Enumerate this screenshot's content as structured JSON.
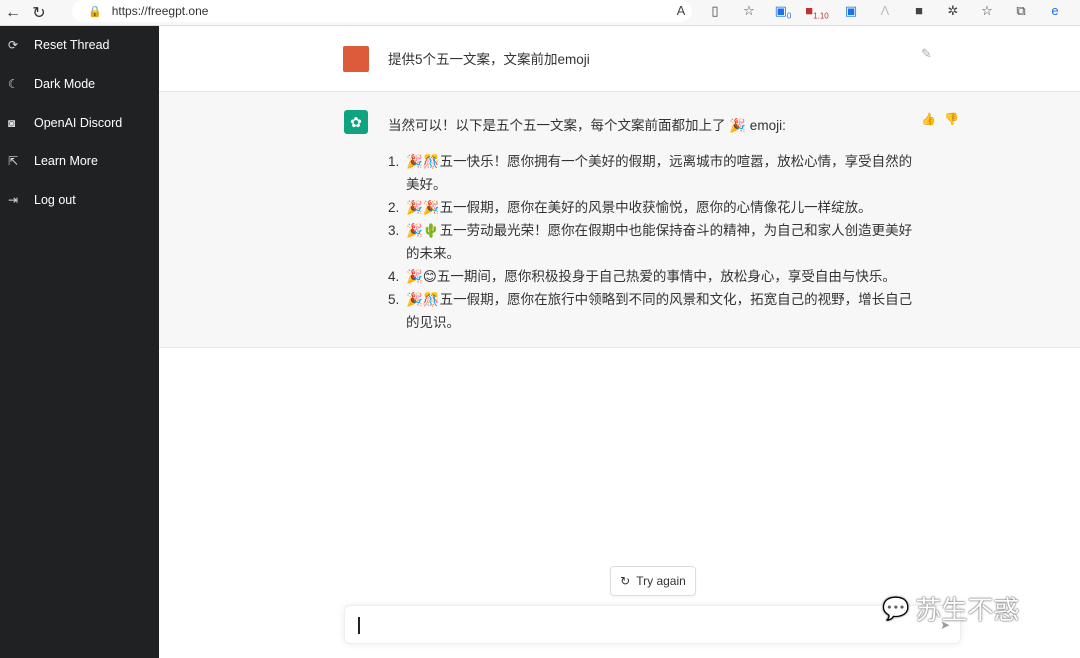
{
  "browser": {
    "url": "https://freegpt.one",
    "badges": [
      "0",
      "1.10"
    ]
  },
  "sidebar": {
    "items": [
      {
        "icon": "refresh-icon",
        "glyph": "⟳",
        "label": "Reset Thread"
      },
      {
        "icon": "moon-icon",
        "glyph": "☾",
        "label": "Dark Mode"
      },
      {
        "icon": "discord-icon",
        "glyph": "◙",
        "label": "OpenAI Discord"
      },
      {
        "icon": "external-link-icon",
        "glyph": "⇱",
        "label": "Learn More"
      },
      {
        "icon": "logout-icon",
        "glyph": "⇥",
        "label": "Log out"
      }
    ]
  },
  "chat": {
    "user_message": "提供5个五一文案，文案前加emoji",
    "bot_intro": "当然可以！以下是五个五一文案，每个文案前面都加上了 🎉 emoji:",
    "items": [
      {
        "n": "1.",
        "text": "🎉🎊五一快乐！愿你拥有一个美好的假期，远离城市的喧嚣，放松心情，享受自然的美好。"
      },
      {
        "n": "2.",
        "text": "🎉🎉五一假期，愿你在美好的风景中收获愉悦，愿你的心情像花儿一样绽放。"
      },
      {
        "n": "3.",
        "text": "🎉🌵五一劳动最光荣！愿你在假期中也能保持奋斗的精神，为自己和家人创造更美好的未来。"
      },
      {
        "n": "4.",
        "text": "🎉😊五一期间，愿你积极投身于自己热爱的事情中，放松身心，享受自由与快乐。"
      },
      {
        "n": "5.",
        "text": "🎉🎊五一假期，愿你在旅行中领略到不同的风景和文化，拓宽自己的视野，增长自己的见识。"
      }
    ]
  },
  "try_again": "Try again",
  "watermark": "苏生不惑"
}
